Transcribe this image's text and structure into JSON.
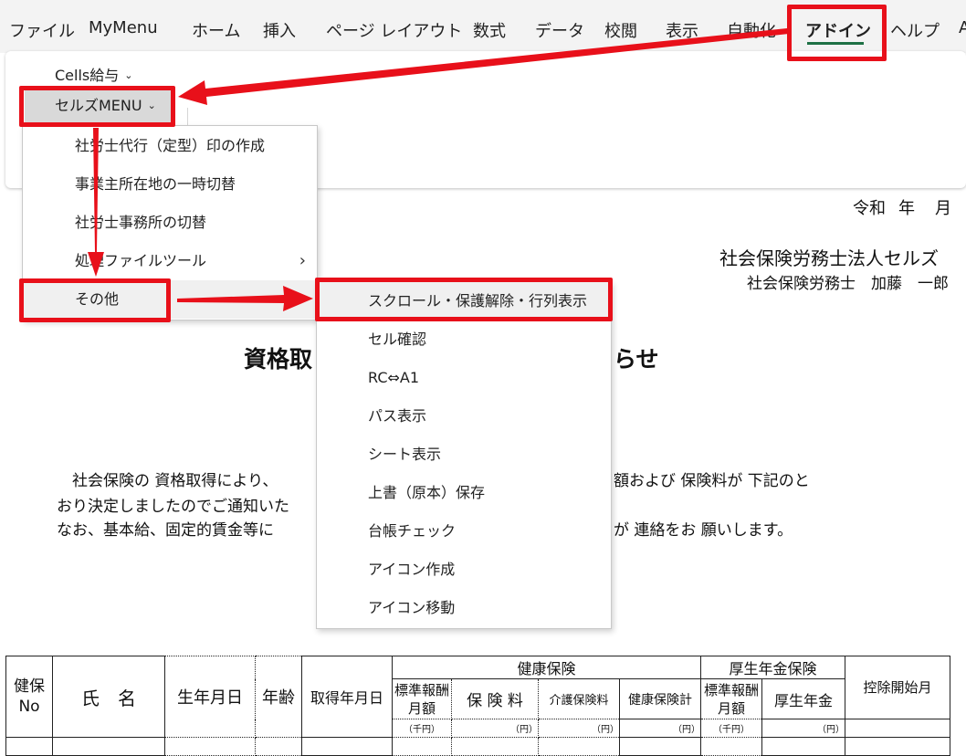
{
  "ribbon_tabs": [
    "ファイル",
    "MyMenu",
    "ホーム",
    "挿入",
    "ページ レイアウト",
    "数式",
    "データ",
    "校閲",
    "表示",
    "自動化",
    "アドイン",
    "ヘルプ",
    "A"
  ],
  "active_tab": "アドイン",
  "ribbon": {
    "cells_kyuyo": "Cells給与",
    "cellz_menu": "セルズMENU"
  },
  "dropdown_menu": {
    "items": [
      "社労士代行（定型）印の作成",
      "事業主所在地の一時切替",
      "社労士事務所の切替",
      "処理ファイルツール",
      "その他"
    ]
  },
  "submenu": {
    "items": [
      "スクロール・保護解除・行列表示",
      "セル確認",
      "RC⇔A1",
      "パス表示",
      "シート表示",
      "上書（原本）保存",
      "台帳チェック",
      "アイコン作成",
      "アイコン移動"
    ]
  },
  "document": {
    "date_era": "令和",
    "date_year": "年",
    "date_month": "月",
    "firm": "社会保険労務士法人セルズ",
    "person": "社会保険労務士　加藤　一郎",
    "title_left": "資格取",
    "title_right": "らせ",
    "body_line1_left": "　社会保険の 資格取得により、",
    "body_line1_right": "額および 保険料が 下記のと",
    "body_line2_left": "おり決定しましたのでご通知いた",
    "body_line3_left": "なお、基本給、固定的賃金等に",
    "body_line3_right": "が 連絡をお 願いします。"
  },
  "table": {
    "col_kenpo_no": "健保No",
    "col_name": "氏　名",
    "col_birth": "生年月日",
    "col_age": "年齢",
    "col_acquired": "取得年月日",
    "group_health": "健康保険",
    "group_pension": "厚生年金保険",
    "col_std_remun": "標準報酬月額",
    "col_premium": "保 険 料",
    "col_care": "介護保険料",
    "col_health_total": "健康保険計",
    "col_pension_std": "標準報酬月額",
    "col_pension": "厚生年金",
    "col_deduct_start": "控除開始月",
    "unit_thousand_yen": "（千円）",
    "unit_yen": "（円）"
  },
  "colors": {
    "annotation_red": "#e8101a",
    "active_tab_underline": "#1e7145"
  }
}
